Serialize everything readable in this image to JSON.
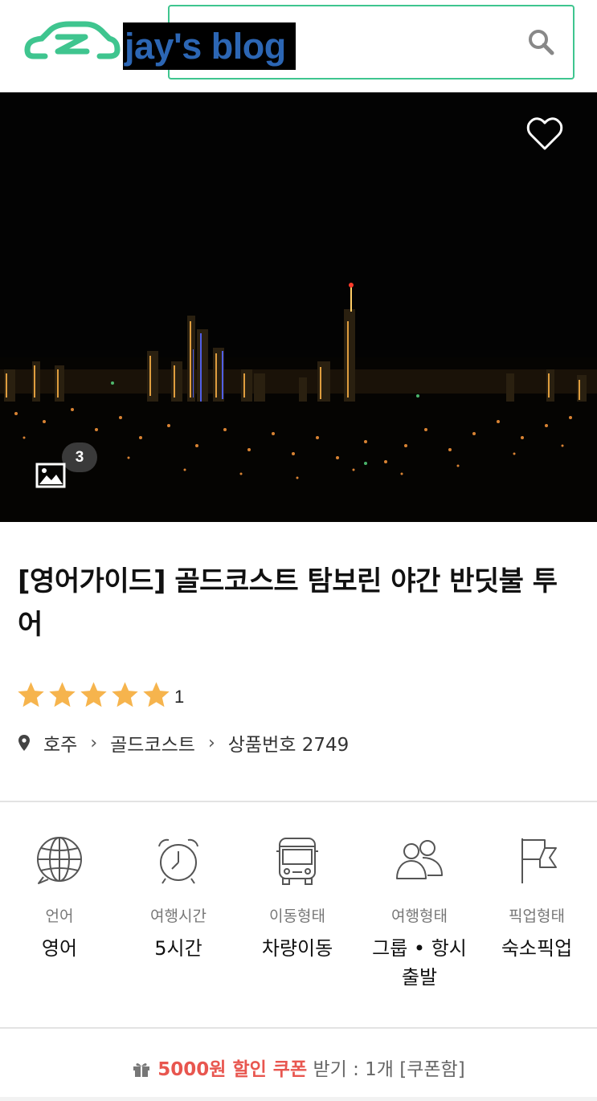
{
  "header": {
    "blog_label": "jay's blog",
    "brand_color": "#3fc58f"
  },
  "hero": {
    "photo_count": "3"
  },
  "product": {
    "title": "[영어가이드] 골드코스트 탐보린 야간 반딧불 투어",
    "rating_stars": 5,
    "review_count": "1",
    "breadcrumb": {
      "country": "호주",
      "city": "골드코스트",
      "product_no": "상품번호 2749"
    }
  },
  "info": [
    {
      "icon": "globe-icon",
      "label": "언어",
      "value": "영어"
    },
    {
      "icon": "alarm-clock-icon",
      "label": "여행시간",
      "value": "5시간"
    },
    {
      "icon": "bus-icon",
      "label": "이동형태",
      "value": "차량이동"
    },
    {
      "icon": "group-icon",
      "label": "여행형태",
      "value": "그룹 • 항시 출발"
    },
    {
      "icon": "flag-icon",
      "label": "픽업형태",
      "value": "숙소픽업"
    }
  ],
  "coupon": {
    "highlight": "5000원 할인 쿠폰",
    "rest": " 받기 : 1개 [쿠폰함]",
    "accent": "#e8564f"
  }
}
